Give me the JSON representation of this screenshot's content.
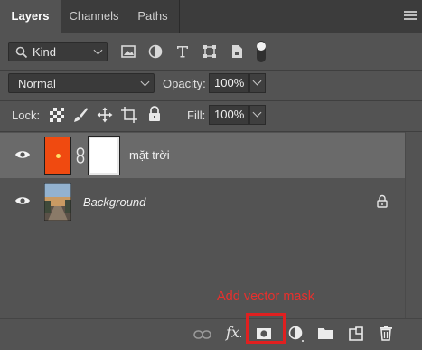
{
  "tabs": [
    {
      "label": "Layers",
      "active": true
    },
    {
      "label": "Channels",
      "active": false
    },
    {
      "label": "Paths",
      "active": false
    }
  ],
  "filter": {
    "kind_label": "Kind"
  },
  "blend": {
    "mode": "Normal",
    "opacity_label": "Opacity:",
    "opacity_value": "100%"
  },
  "lock": {
    "label": "Lock:",
    "fill_label": "Fill:",
    "fill_value": "100%"
  },
  "layers": [
    {
      "name": "mặt trời",
      "selected": true
    },
    {
      "name": "Background",
      "selected": false
    }
  ],
  "annotation": "Add vector mask",
  "bottom_bar": {
    "fx_label": "fx"
  },
  "colors": {
    "panel_bg": "#535353",
    "tab_bg": "#3c3c3c",
    "selected_row": "#6a6a6a",
    "annotation_red": "#e8302d",
    "sun_orange": "#f04a10"
  },
  "icons": [
    "search-icon",
    "image-filter-icon",
    "adjustment-filter-icon",
    "type-filter-icon",
    "shape-filter-icon",
    "smart-object-filter-icon",
    "filter-toggle-icon",
    "lock-transparent-icon",
    "lock-image-icon",
    "lock-position-icon",
    "lock-artboard-icon",
    "lock-all-icon",
    "eye-icon",
    "link-icon",
    "lock-icon",
    "link-layers-icon",
    "fx-icon",
    "add-mask-icon",
    "adjustment-layer-icon",
    "folder-icon",
    "new-layer-icon",
    "trash-icon"
  ]
}
